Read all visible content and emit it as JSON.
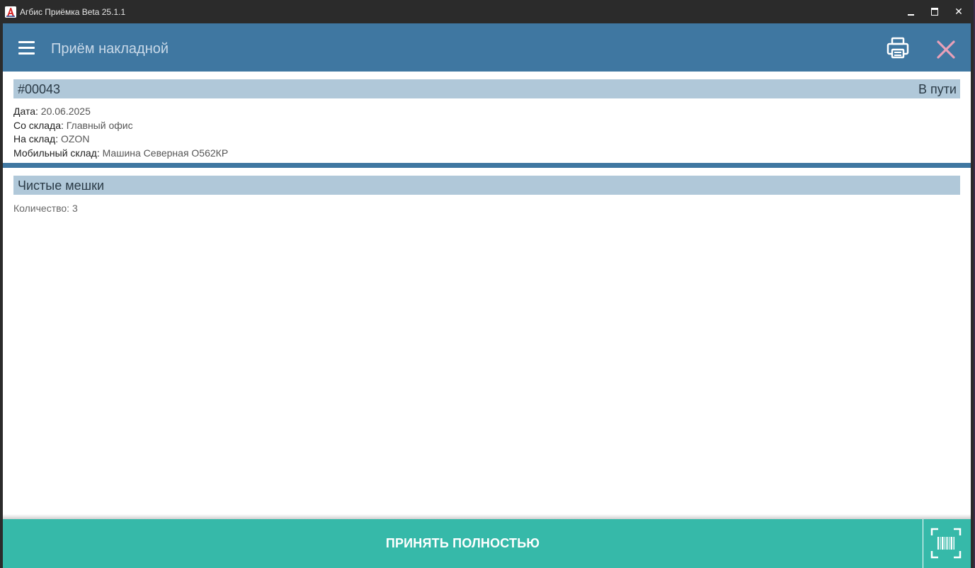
{
  "window": {
    "title": "Агбис Приёмка Beta 25.1.1",
    "icon": "app-logo-icon",
    "controls": {
      "minimize": "minimize-icon",
      "maximize": "maximize-icon",
      "close": "✕"
    }
  },
  "appbar": {
    "title": "Приём накладной",
    "menu_icon": "menu-icon",
    "print_icon": "printer-icon",
    "close_icon": "close-icon",
    "bg_color": "#3f77a1",
    "close_color": "#e8a0b8"
  },
  "document": {
    "number": "#00043",
    "status": "В пути",
    "fields": [
      {
        "label": "Дата:",
        "value": "20.06.2025"
      },
      {
        "label": "Со склада:",
        "value": "Главный офис"
      },
      {
        "label": "На склад:",
        "value": "OZON"
      },
      {
        "label": "Мобильный склад:",
        "value": "Машина Северная О562КР"
      }
    ]
  },
  "items": [
    {
      "name": "Чистые мешки",
      "quantity_text": "Количество: 3"
    }
  ],
  "footer": {
    "accept_label": "ПРИНЯТЬ ПОЛНОСТЬЮ",
    "scan_icon": "barcode-scan-icon",
    "bg_color": "#36b9a9"
  }
}
